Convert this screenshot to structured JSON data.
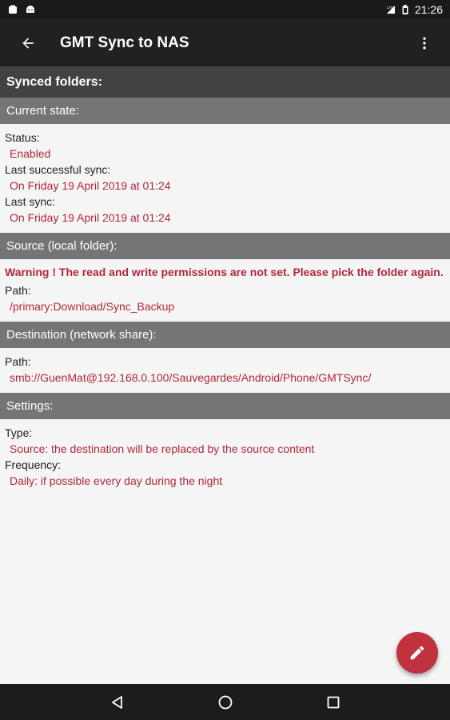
{
  "status_bar": {
    "time": "21:26",
    "icons": [
      "notification-icon",
      "android-icon",
      "signal-icon",
      "battery-icon"
    ]
  },
  "app_bar": {
    "title": "GMT Sync to NAS",
    "back_icon": "arrow-back-icon",
    "menu_icon": "more-vert-icon"
  },
  "page": {
    "header": "Synced folders:"
  },
  "current_state": {
    "title": "Current state:",
    "status_label": "Status:",
    "status_value": "Enabled",
    "last_success_label": "Last successful sync:",
    "last_success_value": "On Friday 19 April 2019 at 01:24",
    "last_sync_label": "Last sync:",
    "last_sync_value": "On Friday 19 April 2019 at 01:24"
  },
  "source": {
    "title": "Source (local folder):",
    "warning": "Warning ! The read and write permissions are not set. Please pick the folder again.",
    "path_label": "Path:",
    "path_value": "/primary:Download/Sync_Backup"
  },
  "destination": {
    "title": "Destination (network share):",
    "path_label": "Path:",
    "path_value": "smb://GuenMat@192.168.0.100/Sauvegardes/Android/Phone/GMTSync/"
  },
  "settings": {
    "title": "Settings:",
    "type_label": "Type:",
    "type_value": "Source: the destination will be replaced by the source content",
    "frequency_label": "Frequency:",
    "frequency_value": "Daily: if possible every day during the night"
  },
  "fab": {
    "icon": "edit-pencil-icon"
  },
  "nav_bar": {
    "back": "nav-back-icon",
    "home": "nav-home-icon",
    "recents": "nav-recents-icon"
  },
  "colors": {
    "app_bar": "#212121",
    "page_header": "#424242",
    "section_header": "#757575",
    "value_text": "#b0273a",
    "fab": "#c0323e",
    "background": "#f5f5f5"
  }
}
